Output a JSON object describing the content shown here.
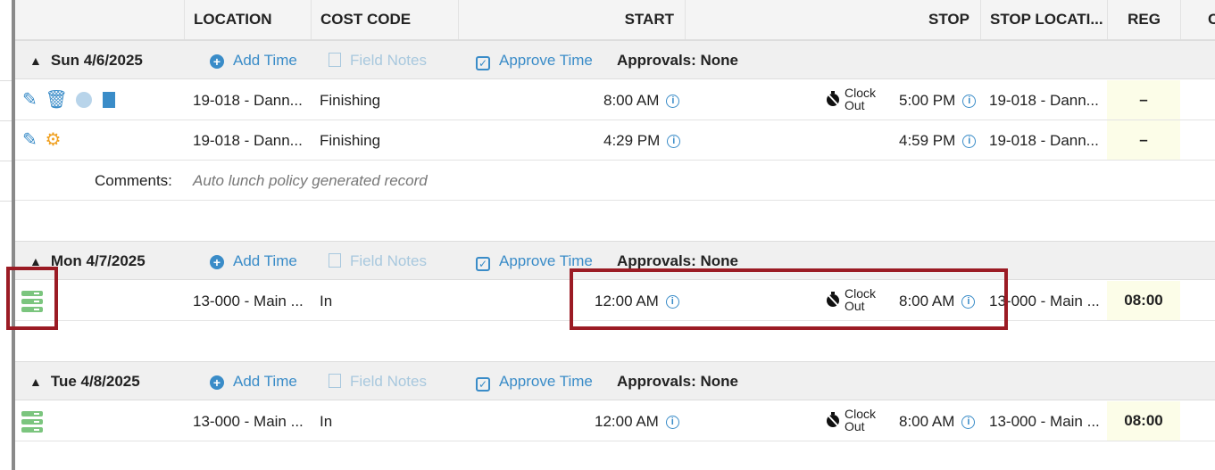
{
  "header": {
    "location": "LOCATION",
    "cost_code": "COST CODE",
    "start": "START",
    "stop": "STOP",
    "stop_location": "STOP LOCATI...",
    "reg": "REG",
    "next_col": "C"
  },
  "groups": [
    {
      "date": "Sun 4/6/2025",
      "add_time": "Add Time",
      "field_notes": "Field Notes",
      "approve_time": "Approve Time",
      "approvals": "Approvals: None",
      "rows": [
        {
          "location": "19-018 - Dann...",
          "cost_code": "Finishing",
          "start": "8:00 AM",
          "clock_line1": "Clock",
          "clock_line2": "Out",
          "stop": "5:00 PM",
          "stop_location": "19-018 - Dann...",
          "reg": "–"
        },
        {
          "location": "19-018 - Dann...",
          "cost_code": "Finishing",
          "start": "4:29 PM",
          "stop": "4:59 PM",
          "stop_location": "19-018 - Dann...",
          "reg": "–"
        }
      ],
      "comments_label": "Comments:",
      "comments_text": "Auto lunch policy generated record"
    },
    {
      "date": "Mon 4/7/2025",
      "add_time": "Add Time",
      "field_notes": "Field Notes",
      "approve_time": "Approve Time",
      "approvals": "Approvals: None",
      "rows": [
        {
          "location": "13-000 - Main ...",
          "cost_code": "In",
          "start": "12:00 AM",
          "clock_line1": "Clock",
          "clock_line2": "Out",
          "stop": "8:00 AM",
          "stop_location": "13-000 - Main ...",
          "reg": "08:00"
        }
      ]
    },
    {
      "date": "Tue 4/8/2025",
      "add_time": "Add Time",
      "field_notes": "Field Notes",
      "approve_time": "Approve Time",
      "approvals": "Approvals: None",
      "rows": [
        {
          "location": "13-000 - Main ...",
          "cost_code": "In",
          "start": "12:00 AM",
          "clock_line1": "Clock",
          "clock_line2": "Out",
          "stop": "8:00 AM",
          "stop_location": "13-000 - Main ...",
          "reg": "08:00"
        }
      ]
    }
  ],
  "colors": {
    "link": "#3a8cc8",
    "link_disabled": "#a8c8de",
    "highlight_box": "#9b1b24",
    "reg_bg": "#fcfde8",
    "server_icon": "#7bc57e",
    "gear_icon": "#f0a020"
  }
}
